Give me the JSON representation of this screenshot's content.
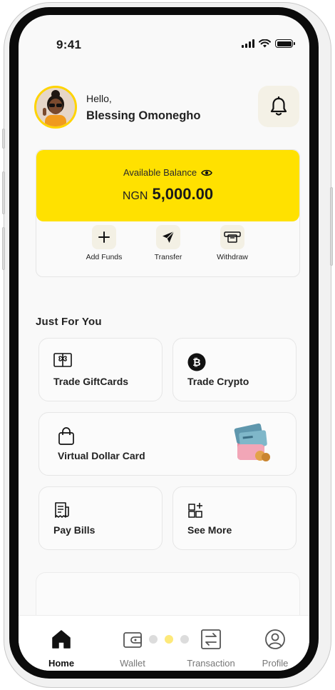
{
  "status_bar": {
    "time": "9:41"
  },
  "header": {
    "greeting": "Hello,",
    "user_name": "Blessing Omonegho",
    "avatar": "user-avatar",
    "notification_icon": "bell-icon"
  },
  "balance": {
    "label": "Available Balance",
    "currency": "NGN",
    "amount": "5,000.00",
    "card_color": "#FFE100",
    "visibility_icon": "eye-icon"
  },
  "quick_actions": [
    {
      "label": "Add Funds",
      "icon": "plus-icon"
    },
    {
      "label": "Transfer",
      "icon": "send-icon"
    },
    {
      "label": "Withdraw",
      "icon": "withdraw-icon"
    }
  ],
  "just_for_you": {
    "title": "Just For You",
    "tiles": [
      {
        "label": "Trade GiftCards",
        "icon": "gift-card-icon"
      },
      {
        "label": "Trade Crypto",
        "icon": "bitcoin-icon"
      },
      {
        "label": "Virtual Dollar Card",
        "icon": "shopping-bag-icon"
      },
      {
        "label": "Pay Bills",
        "icon": "bill-icon"
      },
      {
        "label": "See More",
        "icon": "grid-plus-icon"
      }
    ]
  },
  "bottom_nav": [
    {
      "label": "Home",
      "icon": "home-icon",
      "active": true
    },
    {
      "label": "Wallet",
      "icon": "wallet-icon",
      "active": false
    },
    {
      "label": "Transaction",
      "icon": "transfer-arrows-icon",
      "active": false
    },
    {
      "label": "Profile",
      "icon": "user-icon",
      "active": false
    }
  ],
  "pager": {
    "page_count": 3,
    "active_page": 2
  },
  "colors": {
    "accent": "#FFE100",
    "background": "#F9F9F9",
    "text": "#1B1B1B"
  }
}
